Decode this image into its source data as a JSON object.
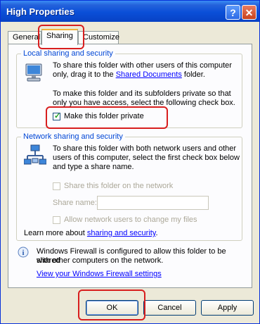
{
  "window": {
    "title": "High Properties",
    "help_label": "?",
    "close_label": "✕"
  },
  "tabs": [
    {
      "label": "General"
    },
    {
      "label": "Sharing"
    },
    {
      "label": "Customize"
    }
  ],
  "local": {
    "legend": "Local sharing and security",
    "line1": "To share this folder with other users of this computer",
    "line2a": "only, drag it to the ",
    "link": "Shared Documents",
    "line2b": " folder.",
    "private_line1": "To make this folder and its subfolders private so that",
    "private_line2": "only you have access, select the following check box.",
    "checkbox_label": "Make this folder private",
    "checkbox_checked": true
  },
  "network": {
    "legend": "Network sharing and security",
    "line1": "To share this folder with both network users and other",
    "line2": "users of this computer, select the first check box below",
    "line3": "and type a share name.",
    "share_checkbox_label": "Share this folder on the network",
    "share_name_label": "Share name:",
    "share_name_value": "",
    "allow_checkbox_label": "Allow network users to change my files",
    "learn_prefix": "Learn more about ",
    "learn_link": "sharing and security",
    "learn_suffix": "."
  },
  "firewall": {
    "line1": "Windows Firewall is configured to allow this folder to be shared",
    "line2": "with other computers on the network.",
    "link": "View your Windows Firewall settings"
  },
  "buttons": {
    "ok": "OK",
    "cancel": "Cancel",
    "apply": "Apply"
  },
  "colors": {
    "annotation": "#d81e1e",
    "title_bar": "#0a4fd8",
    "legend_text": "#0046d5"
  }
}
